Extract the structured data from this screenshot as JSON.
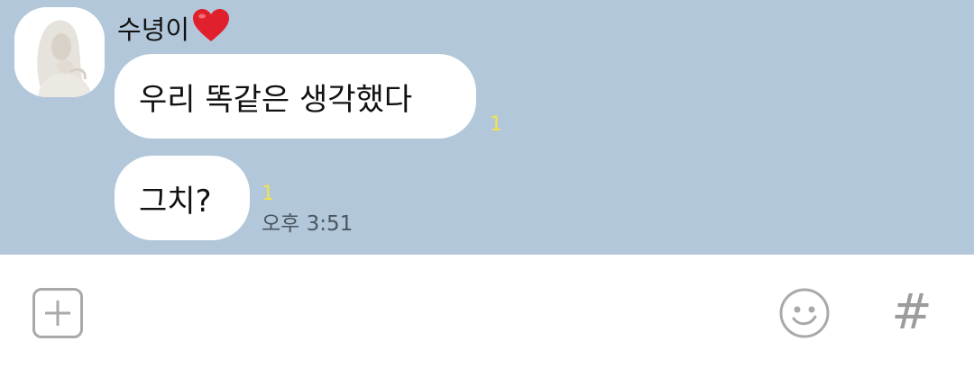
{
  "chat": {
    "background": "#b2c7da",
    "sender": {
      "name": "수녕이",
      "name_icon": "heart-icon",
      "avatar_icon": "profile-photo-hooded-figure"
    },
    "messages": [
      {
        "text": "우리 똑같은 생각했다",
        "unread_count": "1"
      },
      {
        "text": "그치?",
        "unread_count": "1",
        "time": "오후 3:51"
      }
    ]
  },
  "input_bar": {
    "icons": [
      "plus-icon",
      "emoji-icon",
      "hashtag-icon"
    ],
    "hash_label": "#",
    "icon_color": "#a9a9a9"
  }
}
